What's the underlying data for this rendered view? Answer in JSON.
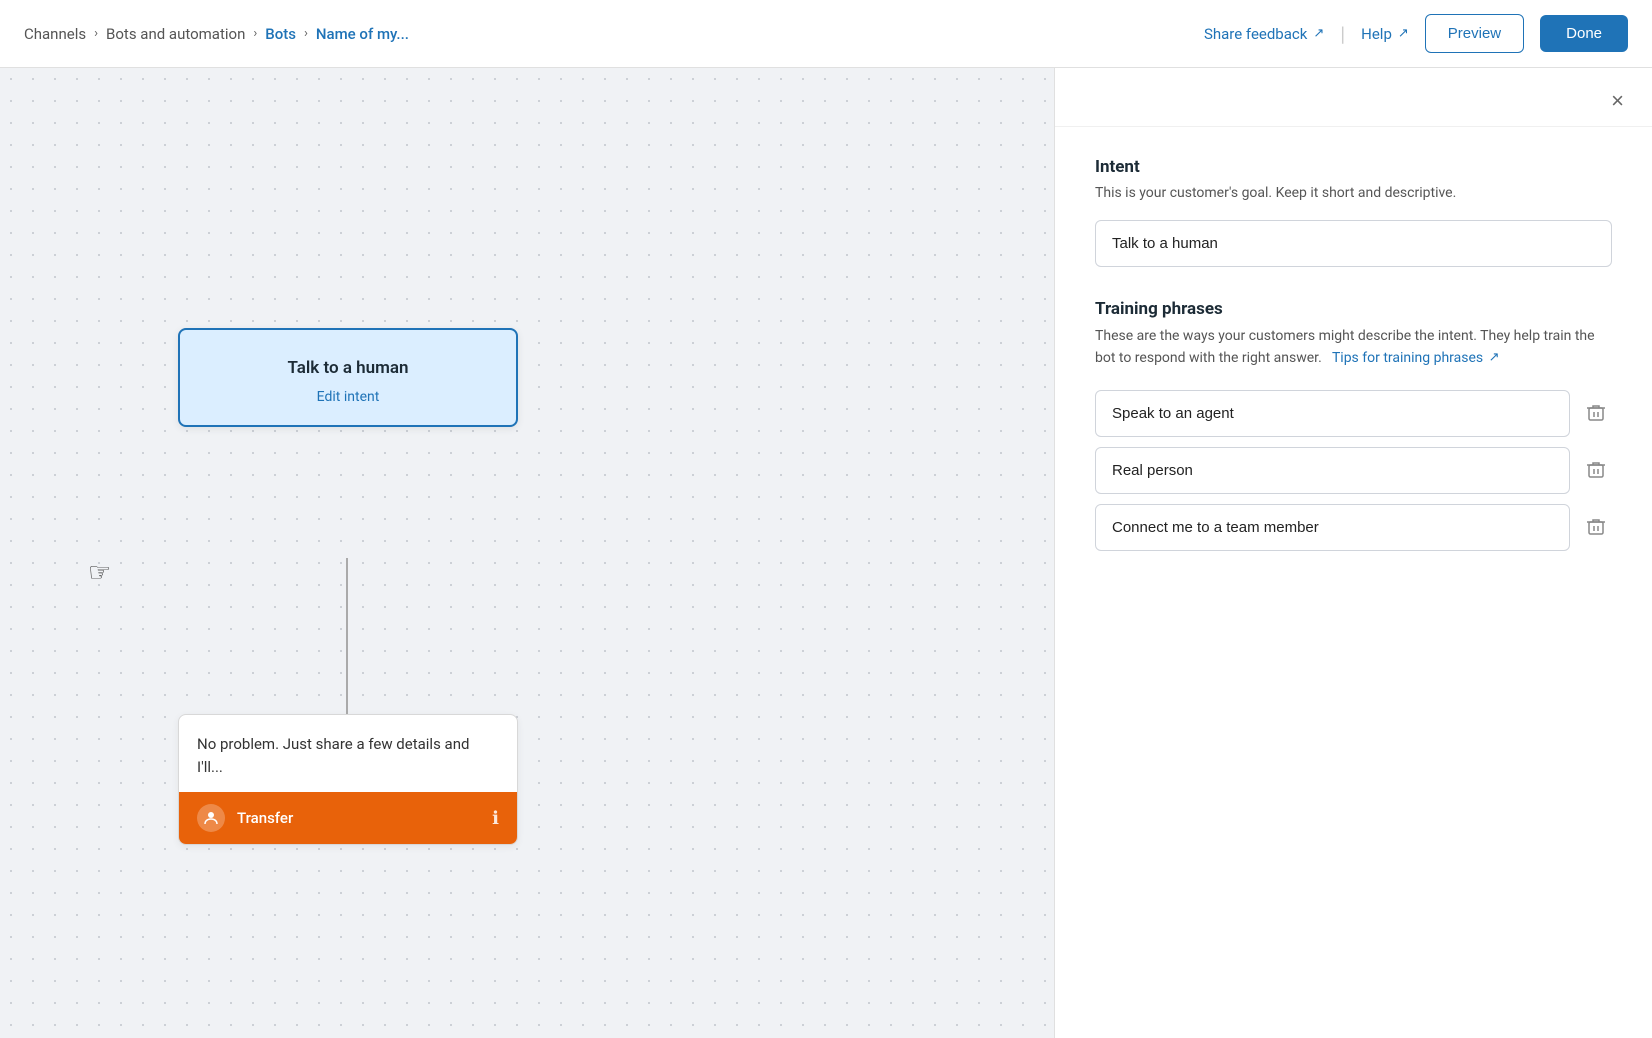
{
  "nav": {
    "breadcrumbs": [
      {
        "label": "Channels",
        "active": false
      },
      {
        "label": "Bots and automation",
        "active": false
      },
      {
        "label": "Bots",
        "active": true
      },
      {
        "label": "Name of my...",
        "active": true
      }
    ],
    "share_feedback": "Share feedback",
    "help": "Help",
    "preview_label": "Preview",
    "done_label": "Done"
  },
  "canvas": {
    "intent_node": {
      "title": "Talk to a human",
      "edit_label": "Edit intent"
    },
    "response_node": {
      "body": "No problem. Just share a few details and I'll...",
      "transfer_label": "Transfer"
    }
  },
  "panel": {
    "close_label": "×",
    "intent_section": {
      "title": "Intent",
      "description": "This is your customer's goal. Keep it short and descriptive.",
      "input_value": "Talk to a human"
    },
    "training_section": {
      "title": "Training phrases",
      "description": "These are the ways your customers might describe the intent. They help train the bot to respond with the right answer.",
      "tips_link_label": "Tips for training phrases",
      "phrases": [
        {
          "id": 1,
          "value": "Speak to an agent"
        },
        {
          "id": 2,
          "value": "Real person"
        },
        {
          "id": 3,
          "value": "Connect me to a team member"
        }
      ]
    }
  }
}
